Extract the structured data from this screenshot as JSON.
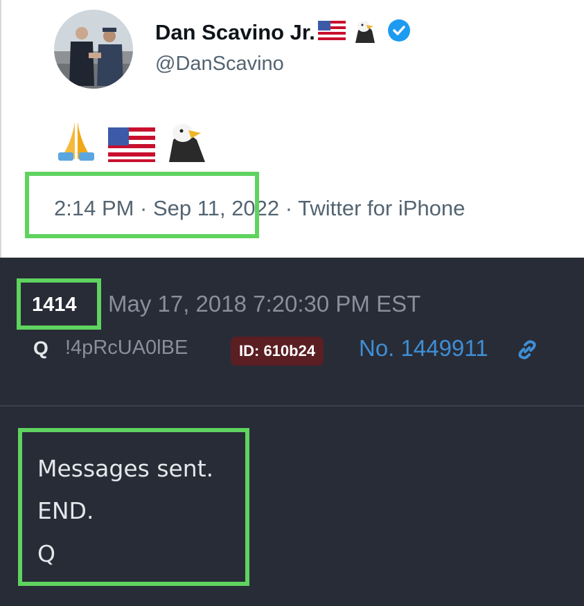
{
  "tweet": {
    "display_name": "Dan Scavino Jr.",
    "handle": "@DanScavino",
    "verified_icon": "verified-badge-icon",
    "name_emojis": [
      "us-flag-icon",
      "eagle-icon"
    ],
    "body_emojis": [
      "praying-hands-icon",
      "us-flag-icon",
      "eagle-icon"
    ],
    "time": "2:14 PM · Sep 11, ",
    "year_source": "2022 · Twitter for iPhone"
  },
  "q_post": {
    "number": "1414",
    "date": "May 17, 2018 7:20:30 PM EST",
    "name": "Q",
    "tripcode": "!4pRcUA0lBE",
    "id_badge": "ID: 610b24",
    "post_no": "No. 1449911",
    "link_icon": "link-icon",
    "message_lines": [
      "Messages sent.",
      "END.",
      "Q"
    ]
  },
  "colors": {
    "highlight": "#5fd35f",
    "verified": "#1d9bf0",
    "q_background": "#282c37",
    "link": "#3f8fd6",
    "id_badge": "#5a1e23"
  }
}
